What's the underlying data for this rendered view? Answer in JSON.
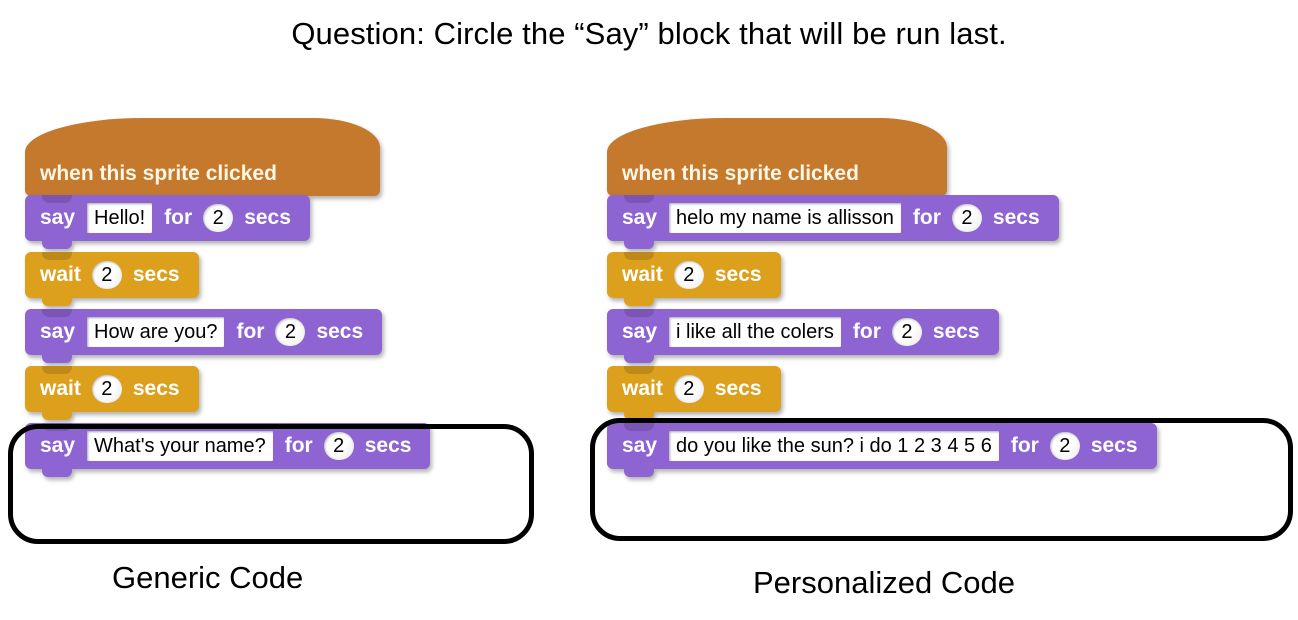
{
  "question": {
    "text": "Question: Circle the “Say” block that will be run last."
  },
  "columns": [
    {
      "id": "generic",
      "caption": "Generic Code",
      "hat": {
        "label": "when this sprite clicked"
      },
      "blocks": [
        {
          "type": "say",
          "say_label": "say",
          "message": "Hello!",
          "for_label": "for",
          "secs": "2",
          "secs_label": "secs",
          "circled": false
        },
        {
          "type": "wait",
          "wait_label": "wait",
          "secs": "2",
          "secs_label": "secs",
          "circled": false
        },
        {
          "type": "say",
          "say_label": "say",
          "message": "How are you?",
          "for_label": "for",
          "secs": "2",
          "secs_label": "secs",
          "circled": false
        },
        {
          "type": "wait",
          "wait_label": "wait",
          "secs": "2",
          "secs_label": "secs",
          "circled": false
        },
        {
          "type": "say",
          "say_label": "say",
          "message": "What's your name?",
          "for_label": "for",
          "secs": "2",
          "secs_label": "secs",
          "circled": true
        }
      ]
    },
    {
      "id": "personalized",
      "caption": "Personalized Code",
      "hat": {
        "label": "when this sprite clicked"
      },
      "blocks": [
        {
          "type": "say",
          "say_label": "say",
          "message": "helo my name is allisson",
          "for_label": "for",
          "secs": "2",
          "secs_label": "secs",
          "circled": false
        },
        {
          "type": "wait",
          "wait_label": "wait",
          "secs": "2",
          "secs_label": "secs",
          "circled": false
        },
        {
          "type": "say",
          "say_label": "say",
          "message": "i like all the colers",
          "for_label": "for",
          "secs": "2",
          "secs_label": "secs",
          "circled": false
        },
        {
          "type": "wait",
          "wait_label": "wait",
          "secs": "2",
          "secs_label": "secs",
          "circled": false
        },
        {
          "type": "say",
          "say_label": "say",
          "message": "do you like the sun? i do 1 2 3 4 5 6",
          "for_label": "for",
          "secs": "2",
          "secs_label": "secs",
          "circled": true
        }
      ]
    }
  ],
  "colors": {
    "event_block": "#c4792c",
    "looks_block": "#8e63d2",
    "control_block": "#dda01d",
    "annotation": "#000000",
    "background": "#ffffff"
  }
}
